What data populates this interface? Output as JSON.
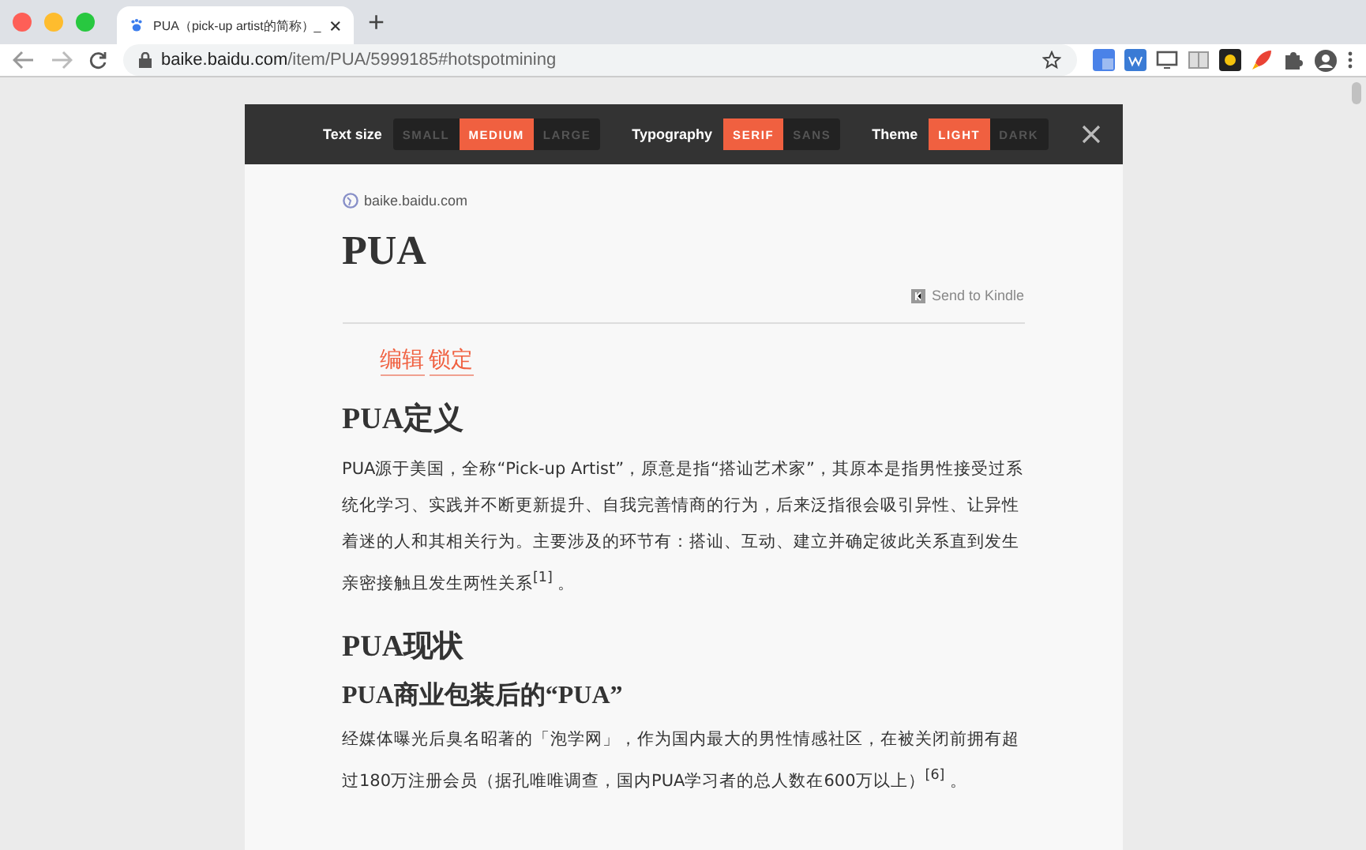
{
  "browser": {
    "tab": {
      "title": "PUA（pick-up artist的简称）_"
    },
    "new_tab": "+",
    "url_host": "baike.baidu.com",
    "url_path": "/item/PUA/5999185#hotspotmining"
  },
  "toolbar": {
    "groups": [
      {
        "label": "Text size",
        "options": [
          {
            "label": "SMALL",
            "selected": false
          },
          {
            "label": "MEDIUM",
            "selected": true
          },
          {
            "label": "LARGE",
            "selected": false
          }
        ]
      },
      {
        "label": "Typography",
        "options": [
          {
            "label": "SERIF",
            "selected": true
          },
          {
            "label": "SANS",
            "selected": false
          }
        ]
      },
      {
        "label": "Theme",
        "options": [
          {
            "label": "LIGHT",
            "selected": true
          },
          {
            "label": "DARK",
            "selected": false
          }
        ]
      }
    ]
  },
  "article": {
    "site": "baike.baidu.com",
    "title": "PUA",
    "send_to_kindle": "Send to Kindle",
    "links": [
      "编辑",
      "锁定"
    ],
    "blocks": [
      {
        "kind": "h2",
        "text": "PUA定义"
      },
      {
        "kind": "p",
        "text": "PUA源于美国，全称“Pick-up Artist”，原意是指“搭讪艺术家”，其原本是指男性接受过系统化学习、实践并不断更新提升、自我完善情商的行为，后来泛指很会吸引异性、让异性着迷的人和其相关行为。主要涉及的环节有：搭讪、互动、建立并确定彼此关系直到发生亲密接触且发生两性关系$^{[1]}$ 。"
      },
      {
        "kind": "h2",
        "text": "PUA现状"
      },
      {
        "kind": "h3",
        "text": "PUA商业包装后的“PUA”"
      },
      {
        "kind": "p",
        "text": "经媒体曝光后臭名昭著的「泡学网」，作为国内最大的男性情感社区，在被关闭前拥有超过180万注册会员（据孔唯唯调查，国内PUA学习者的总人数在600万以上）$^{[6]}$ 。"
      }
    ]
  }
}
